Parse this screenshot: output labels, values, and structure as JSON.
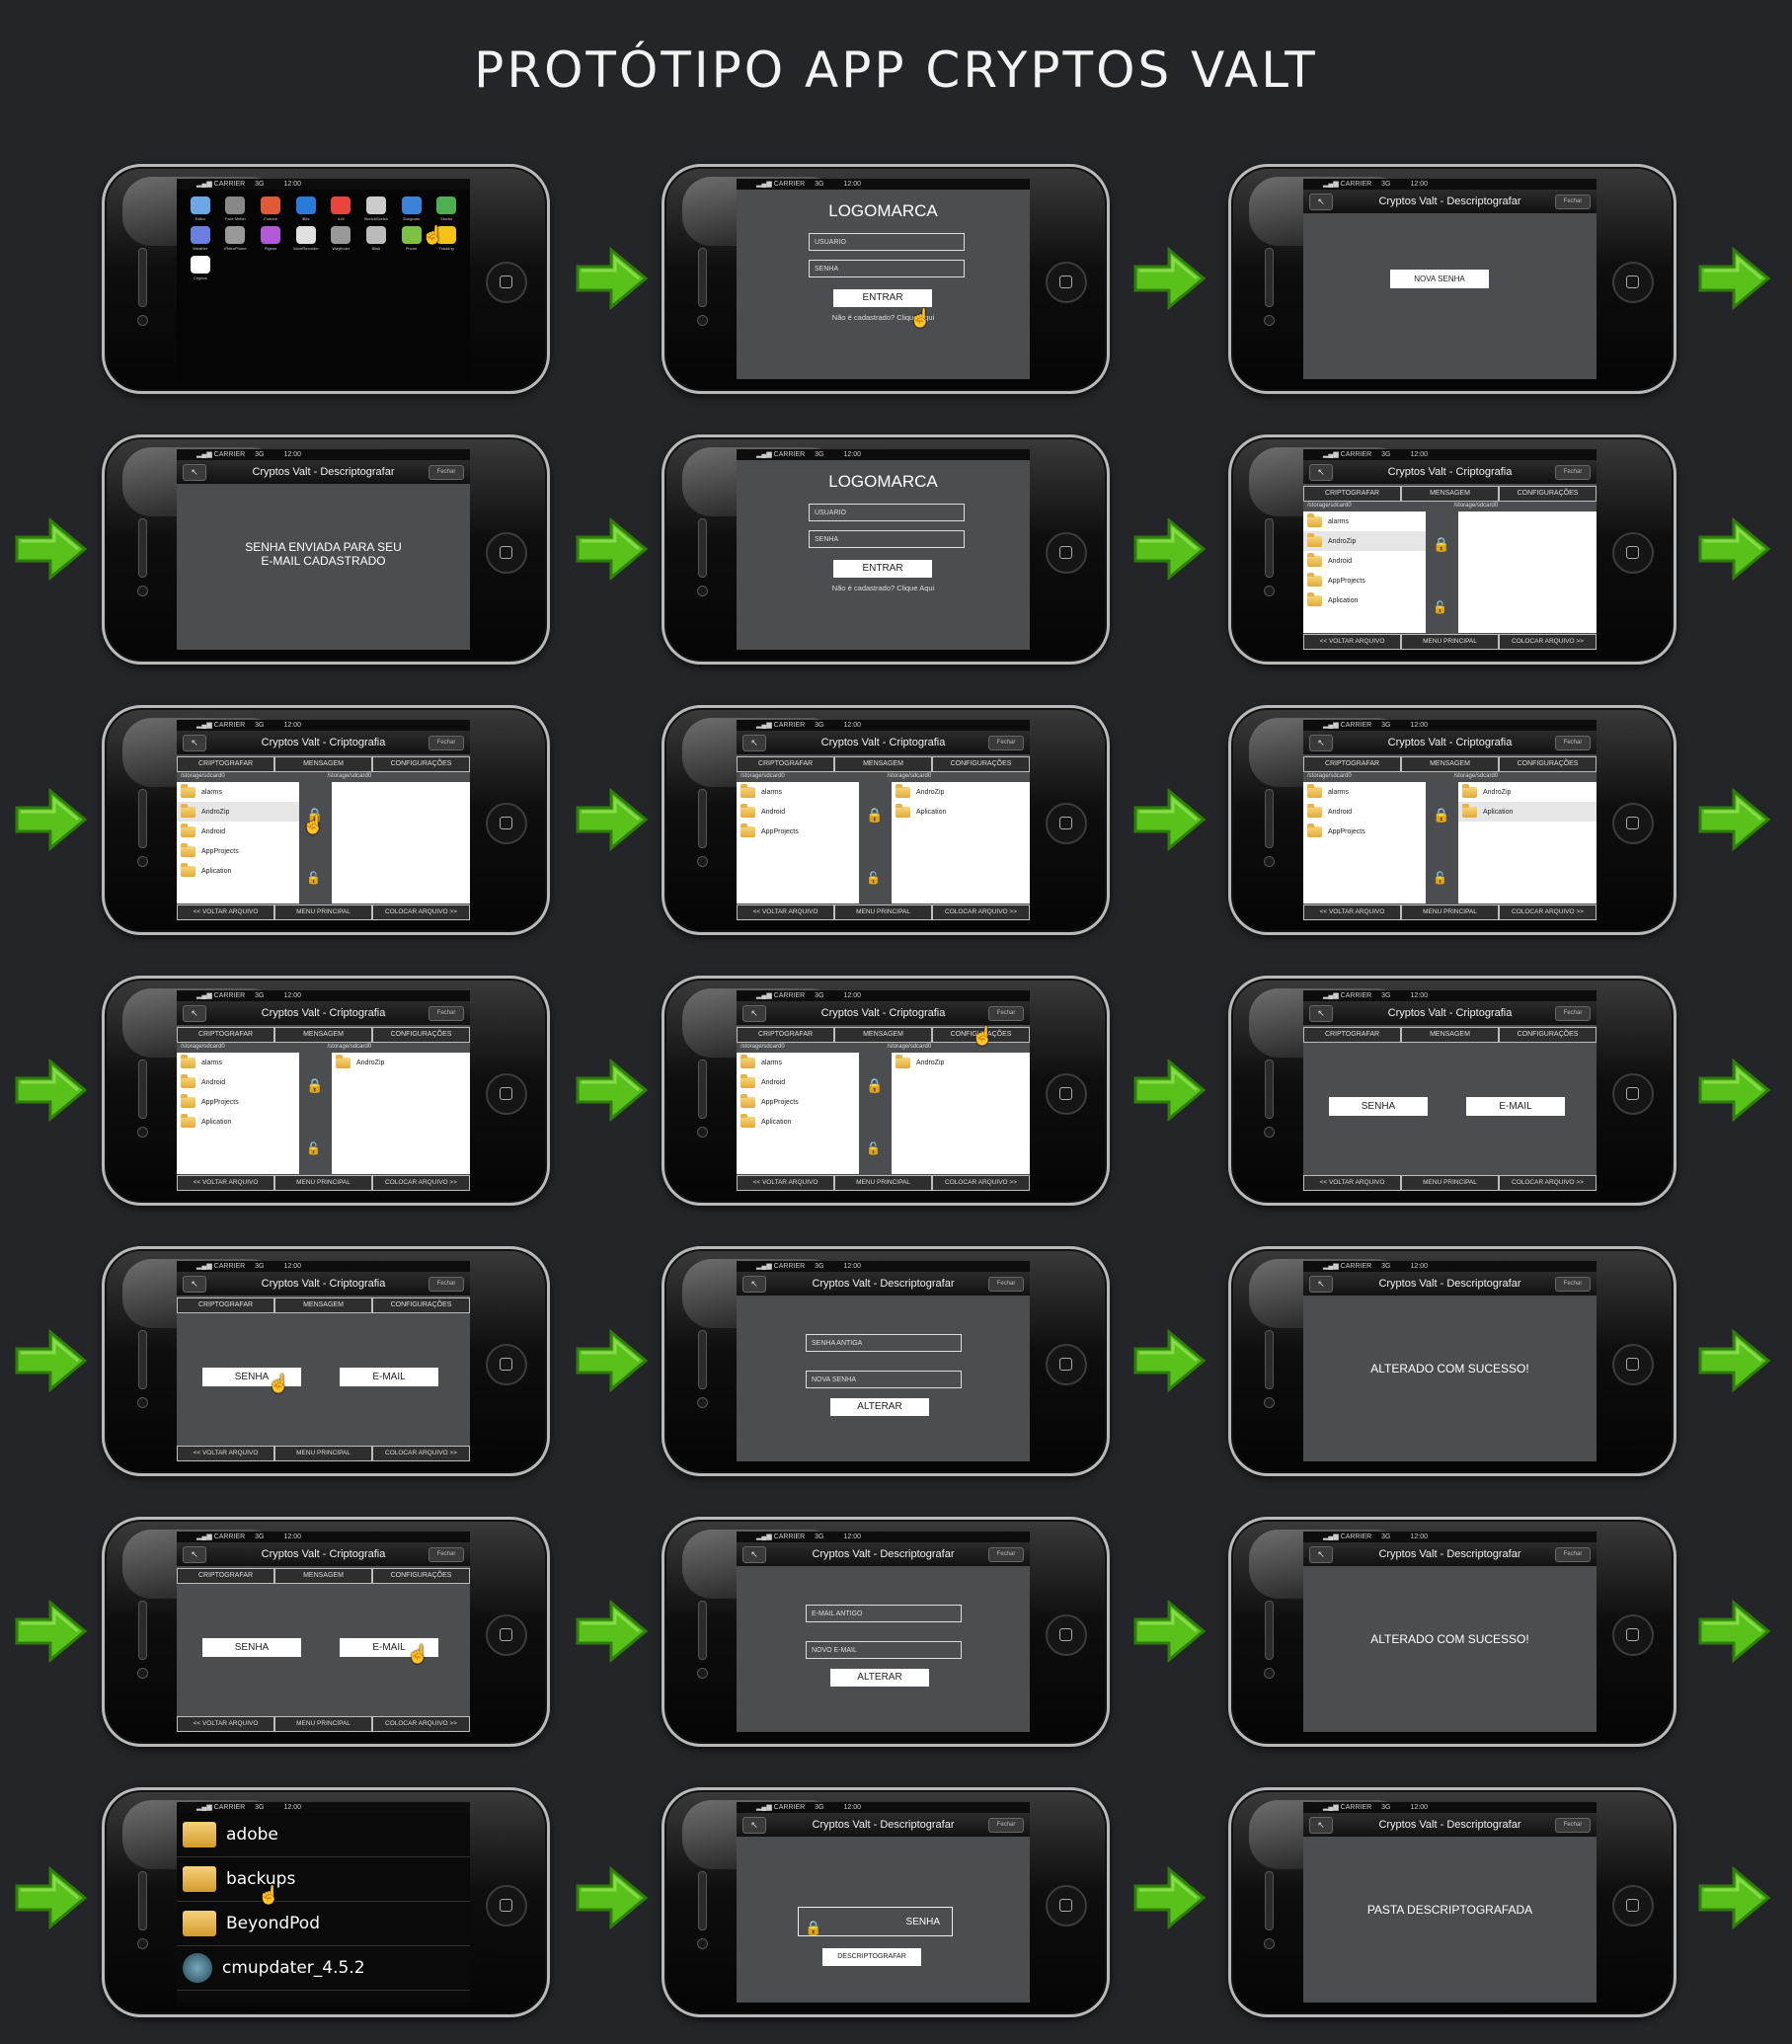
{
  "page": {
    "title": "PROTÓTIPO APP CRYPTOS VALT"
  },
  "common": {
    "carrier": "CARRIER",
    "network": "3G",
    "time": "12:00",
    "close_label": "Fechar",
    "back_icon": "↖",
    "tab_encrypt": "CRIPTOGRAFAR",
    "tab_message": "MENSAGEM",
    "tab_settings": "CONFIGURAÇÕES",
    "footer_back": "<< VOLTAR ARQUIVO",
    "footer_menu": "MENU PRINCIPAL",
    "footer_put": "COLOCAR ARQUIVO >>",
    "path": "/storage/sdcard0",
    "title_decrypt": "Cryptos Valt - Descriptografar",
    "title_encrypt": "Cryptos Valt - Criptografia"
  },
  "login": {
    "logo": "LOGOMARCA",
    "user_placeholder": "USUARIO",
    "pass_placeholder": "SENHA",
    "enter": "ENTRAR",
    "register": "Não é cadastrado? Clique Aqui"
  },
  "home_icons": [
    "Editor",
    "Face Melter",
    "Fortune",
    "iBits",
    "iLM",
    "SketchSketch",
    "Songman",
    "Stocks",
    "Weather",
    "iRetroPhone",
    "Pigeon",
    "VoiceRecorder",
    "Wayfinder",
    "Blink",
    "Phone",
    "Tracking",
    "Cryptos"
  ],
  "screens": {
    "new_password_btn": "NOVA SENHA",
    "sent_msg_line1": "SENHA ENVIADA PARA SEU",
    "sent_msg_line2": "E-MAIL CADASTRADO",
    "senha_btn": "SENHA",
    "email_btn": "E-MAIL",
    "old_pass": "SENHA ANTIGA",
    "new_pass": "NOVA SENHA",
    "alter": "ALTERAR",
    "old_email": "E-MAIL ANTIGO",
    "new_email": "NOVO E-MAIL",
    "success": "ALTERADO COM SUCESSO!",
    "decrypt_btn": "DESCRIPTOGRAFAR",
    "folder_decrypted": "PASTA DESCRIPTOGRAFADA"
  },
  "files_left": [
    "alarms",
    "AndroZip",
    "Android",
    "AppProjects",
    "Aplication"
  ],
  "files_left_b": [
    "alarms",
    "Android",
    "AppProjects"
  ],
  "files_left_c": [
    "alarms",
    "Android",
    "AppProjects",
    "Aplication"
  ],
  "files_right_b": [
    "AndroZip",
    "Aplication"
  ],
  "files_right_c": [
    "AndroZip"
  ],
  "big_files": [
    "adobe",
    "backups",
    "BeyondPod",
    "cmupdater_4.5.2"
  ],
  "colors": {
    "arrow": "#5cbf1a",
    "screen": "#4b4d50",
    "background": "#232528"
  }
}
